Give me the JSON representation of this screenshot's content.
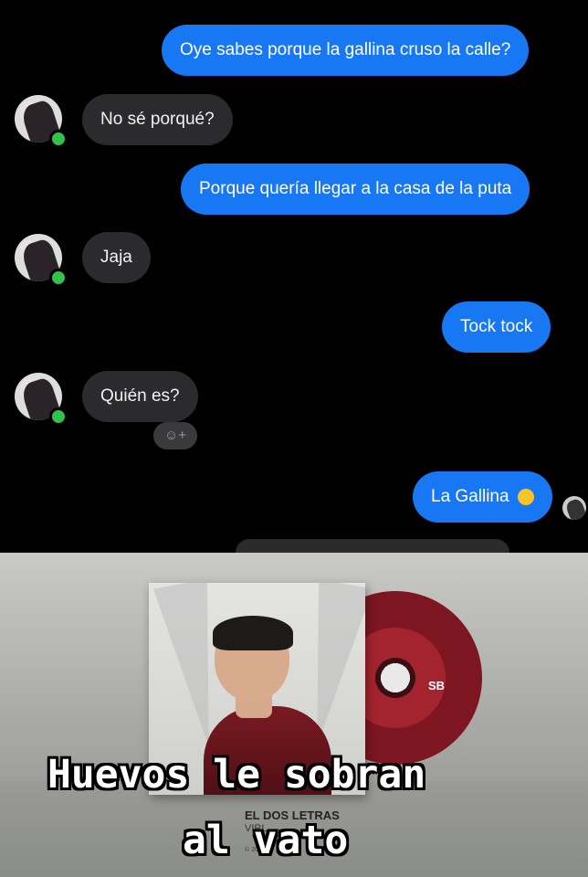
{
  "conversation": {
    "messages": [
      {
        "side": "out",
        "text": "Oye sabes porque la gallina cruso la calle?"
      },
      {
        "side": "in",
        "text": "No sé porqué?"
      },
      {
        "side": "out",
        "text": "Porque quería llegar a la casa de la puta"
      },
      {
        "side": "in",
        "text": "Jaja"
      },
      {
        "side": "out",
        "text": "Tock tock"
      },
      {
        "side": "in",
        "text": "Quién es?"
      },
      {
        "side": "out",
        "text": "La Gallina"
      }
    ],
    "reaction_icon": "smiley-plus-icon",
    "emoji": "smiling-face-icon"
  },
  "meme": {
    "album_artist": "EL DOS LETRAS",
    "album_title_partial": "VIRL",
    "copyright_partial": "© 2018 S",
    "disc_logo": "SB",
    "caption_line1": "Huevos le sobran",
    "caption_line2": "al vato"
  },
  "colors": {
    "outgoing": "#1877f2",
    "incoming": "#2b2b2d",
    "online": "#31c24d"
  }
}
